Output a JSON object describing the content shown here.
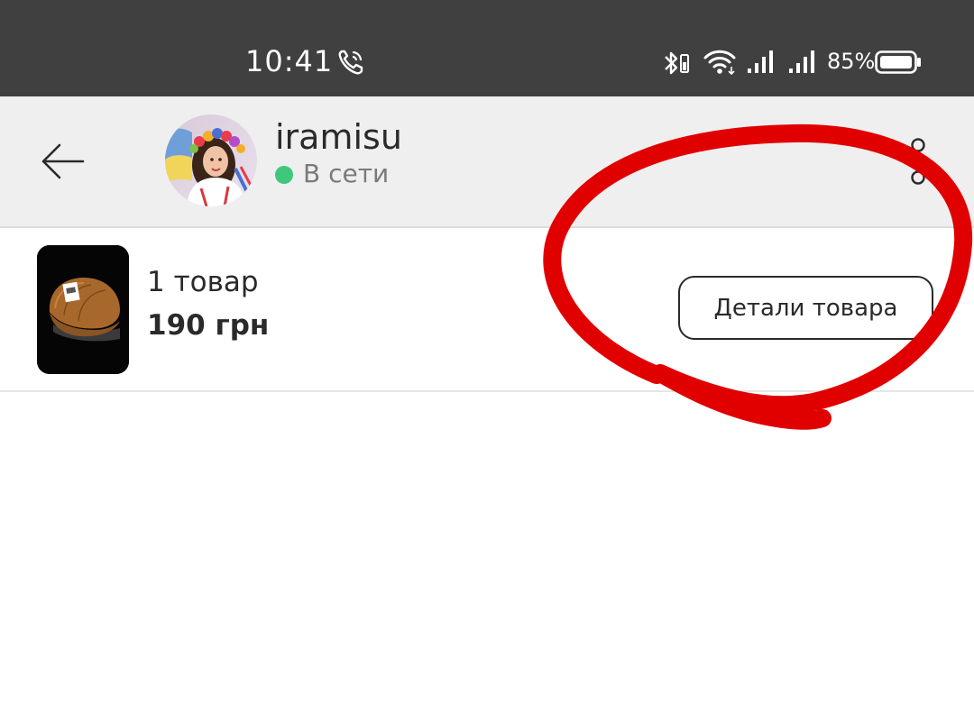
{
  "status_bar": {
    "time": "10:41",
    "battery_percent": "85%",
    "battery_level": 0.85,
    "icons": [
      "call-icon",
      "bluetooth-icon",
      "wifi-icon",
      "signal-icon",
      "signal-icon",
      "battery-icon"
    ],
    "background": "#404040"
  },
  "header": {
    "back_icon": "arrow-left-icon",
    "user_name": "iramisu",
    "status_text": "В сети",
    "status_color": "#3fc77b",
    "menu_icon": "more-vertical-icon",
    "background": "#efefef"
  },
  "product": {
    "count_text": "1 товар",
    "price_text": "190 грн",
    "details_button_label": "Детали товара"
  },
  "annotation": {
    "color": "#e10000",
    "shape": "hand-drawn circle around details button"
  }
}
